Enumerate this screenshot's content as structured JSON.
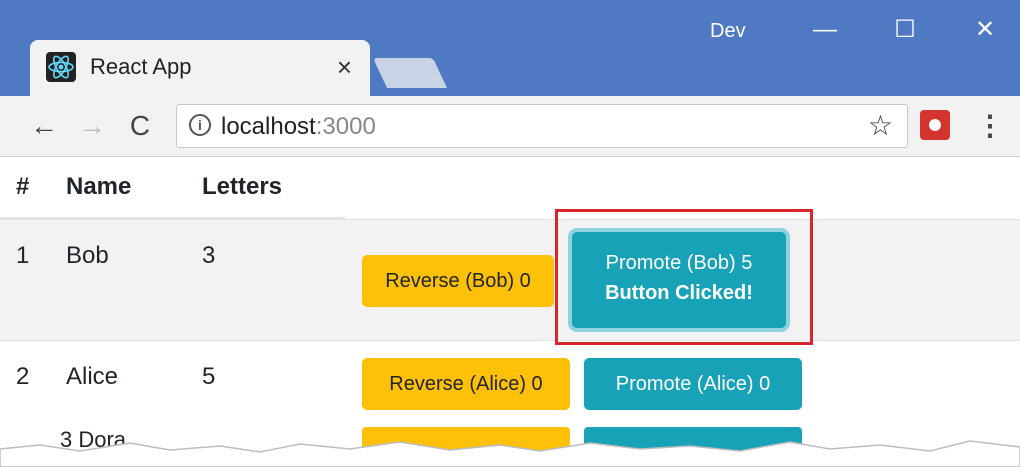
{
  "browser": {
    "tab_title": "React App",
    "tab_close": "×",
    "profile": "Dev",
    "window": {
      "minimize": "—",
      "maximize": "☐",
      "close": "✕"
    },
    "nav": {
      "back": "←",
      "forward": "→",
      "reload": "C"
    },
    "info": "i",
    "url_host": "localhost",
    "url_port": ":3000",
    "star": "☆",
    "menu": "⋮"
  },
  "table": {
    "headers": {
      "num": "#",
      "name": "Name",
      "letters": "Letters"
    },
    "rows": [
      {
        "num": "1",
        "name": "Bob",
        "letters": "3",
        "reverse_label": "Reverse (Bob) 0",
        "promote_label_line1": "Promote (Bob) 5",
        "promote_label_line2": "Button Clicked!"
      },
      {
        "num": "2",
        "name": "Alice",
        "letters": "5",
        "reverse_label": "Reverse (Alice) 0",
        "promote_label": "Promote (Alice) 0"
      }
    ],
    "partial_row_text": "3 Dora"
  },
  "colors": {
    "titlebar": "#4f79c2",
    "warning": "#ffc107",
    "info": "#17a2b8",
    "highlight": "#d9262c"
  }
}
